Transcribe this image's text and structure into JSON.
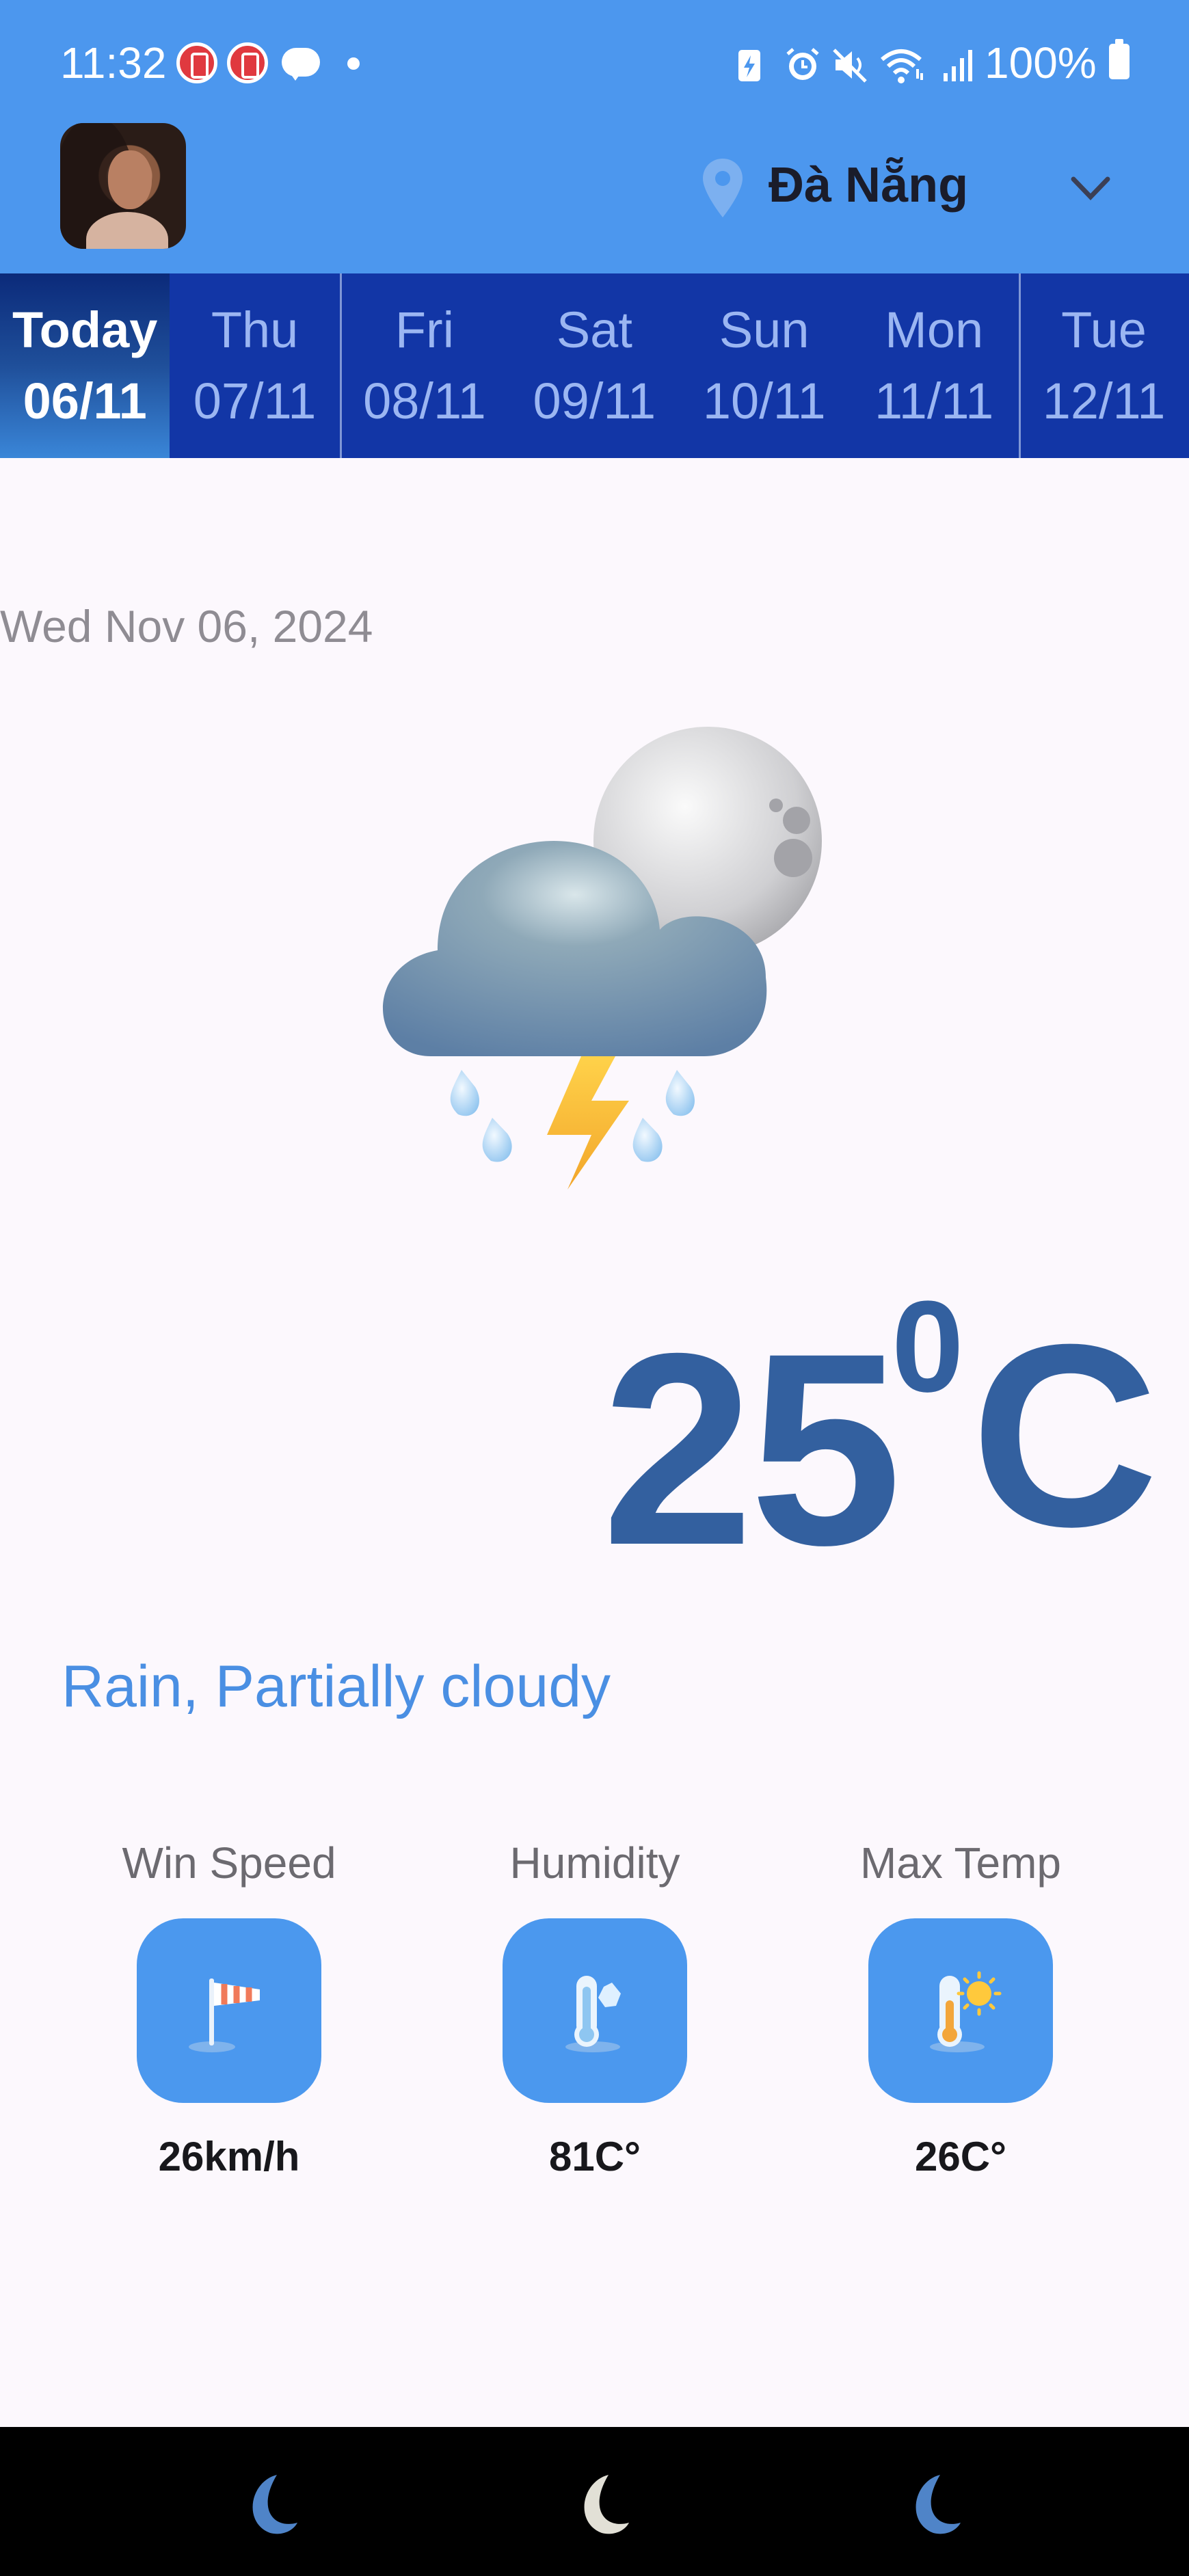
{
  "status_bar": {
    "time": "11:32",
    "battery_percent": "100%",
    "icons": [
      "app-notification-icon",
      "app-notification-icon",
      "chat-bubble-icon",
      "dot-icon",
      "battery-saver-icon",
      "alarm-icon",
      "mute-icon",
      "wifi-icon",
      "signal-icon",
      "battery-icon"
    ]
  },
  "app_bar": {
    "location": "Đà Nẵng"
  },
  "days": [
    {
      "day": "Today",
      "date": "06/11",
      "selected": true
    },
    {
      "day": "Thu",
      "date": "07/11"
    },
    {
      "day": "Fri",
      "date": "08/11"
    },
    {
      "day": "Sat",
      "date": "09/11"
    },
    {
      "day": "Sun",
      "date": "10/11"
    },
    {
      "day": "Mon",
      "date": "11/11"
    },
    {
      "day": "Tue",
      "date": "12/11"
    }
  ],
  "main": {
    "full_date": "Wed Nov 06, 2024",
    "weather_icon": "thunderstorm-night-icon",
    "temperature": "25",
    "temp_sup": "0",
    "temp_unit": "C",
    "condition": "Rain, Partially cloudy"
  },
  "stats": [
    {
      "label": "Win Speed",
      "value": "26km/h",
      "icon": "windsock-icon"
    },
    {
      "label": "Humidity",
      "value": "81C°",
      "icon": "humidity-thermometer-icon"
    },
    {
      "label": "Max Temp",
      "value": "26C°",
      "icon": "sun-thermometer-icon"
    }
  ],
  "colors": {
    "app_bar": "#4c97ee",
    "tabs_bg": "#1236a6",
    "temperature": "#33609f",
    "condition": "#4a8fe3",
    "tile": "#4b98ee"
  }
}
